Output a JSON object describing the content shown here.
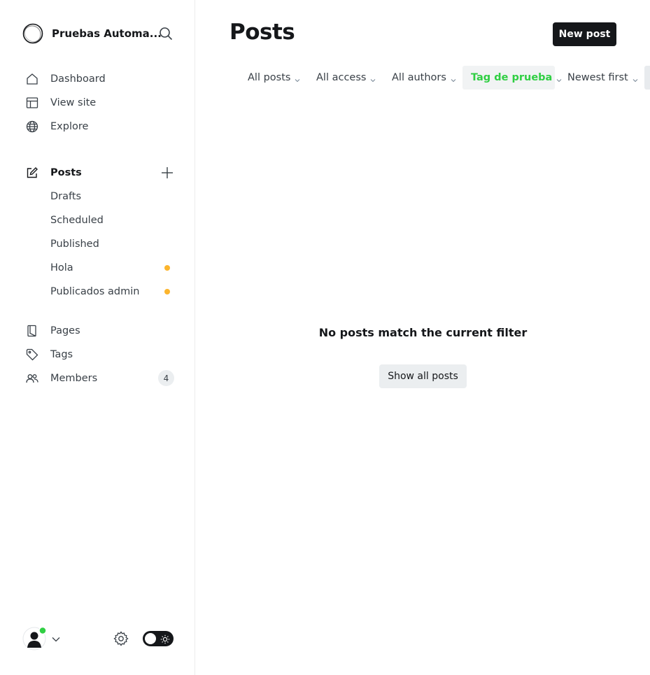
{
  "sidebar": {
    "site_name": "Pruebas Automa...",
    "primary": [
      {
        "label": "Dashboard",
        "icon": "home-icon"
      },
      {
        "label": "View site",
        "icon": "layout-icon"
      },
      {
        "label": "Explore",
        "icon": "globe-icon"
      }
    ],
    "posts": {
      "label": "Posts",
      "icon": "edit-icon",
      "sub": [
        {
          "label": "Drafts"
        },
        {
          "label": "Scheduled"
        },
        {
          "label": "Published"
        },
        {
          "label": "Hola",
          "dot_color": "#fcb52d"
        },
        {
          "label": "Publicados admin",
          "dot_color": "#fcb52d"
        }
      ]
    },
    "secondary": [
      {
        "label": "Pages",
        "icon": "page-icon"
      },
      {
        "label": "Tags",
        "icon": "tag-icon"
      },
      {
        "label": "Members",
        "icon": "members-icon",
        "count": "4"
      }
    ],
    "footer": {
      "status_color": "#30cf43",
      "theme_toggle": "dark"
    }
  },
  "main": {
    "title": "Posts",
    "new_post_label": "New post",
    "filters": [
      {
        "label": "All posts"
      },
      {
        "label": "All access"
      },
      {
        "label": "All authors"
      },
      {
        "label": "Tag de prueba",
        "active": true
      },
      {
        "label": "Newest first"
      }
    ],
    "empty_message": "No posts match the current filter",
    "show_all_label": "Show all posts"
  },
  "colors": {
    "accent_green": "#30cf43",
    "primary_dark": "#15171a",
    "dot_orange": "#fcb52d"
  }
}
